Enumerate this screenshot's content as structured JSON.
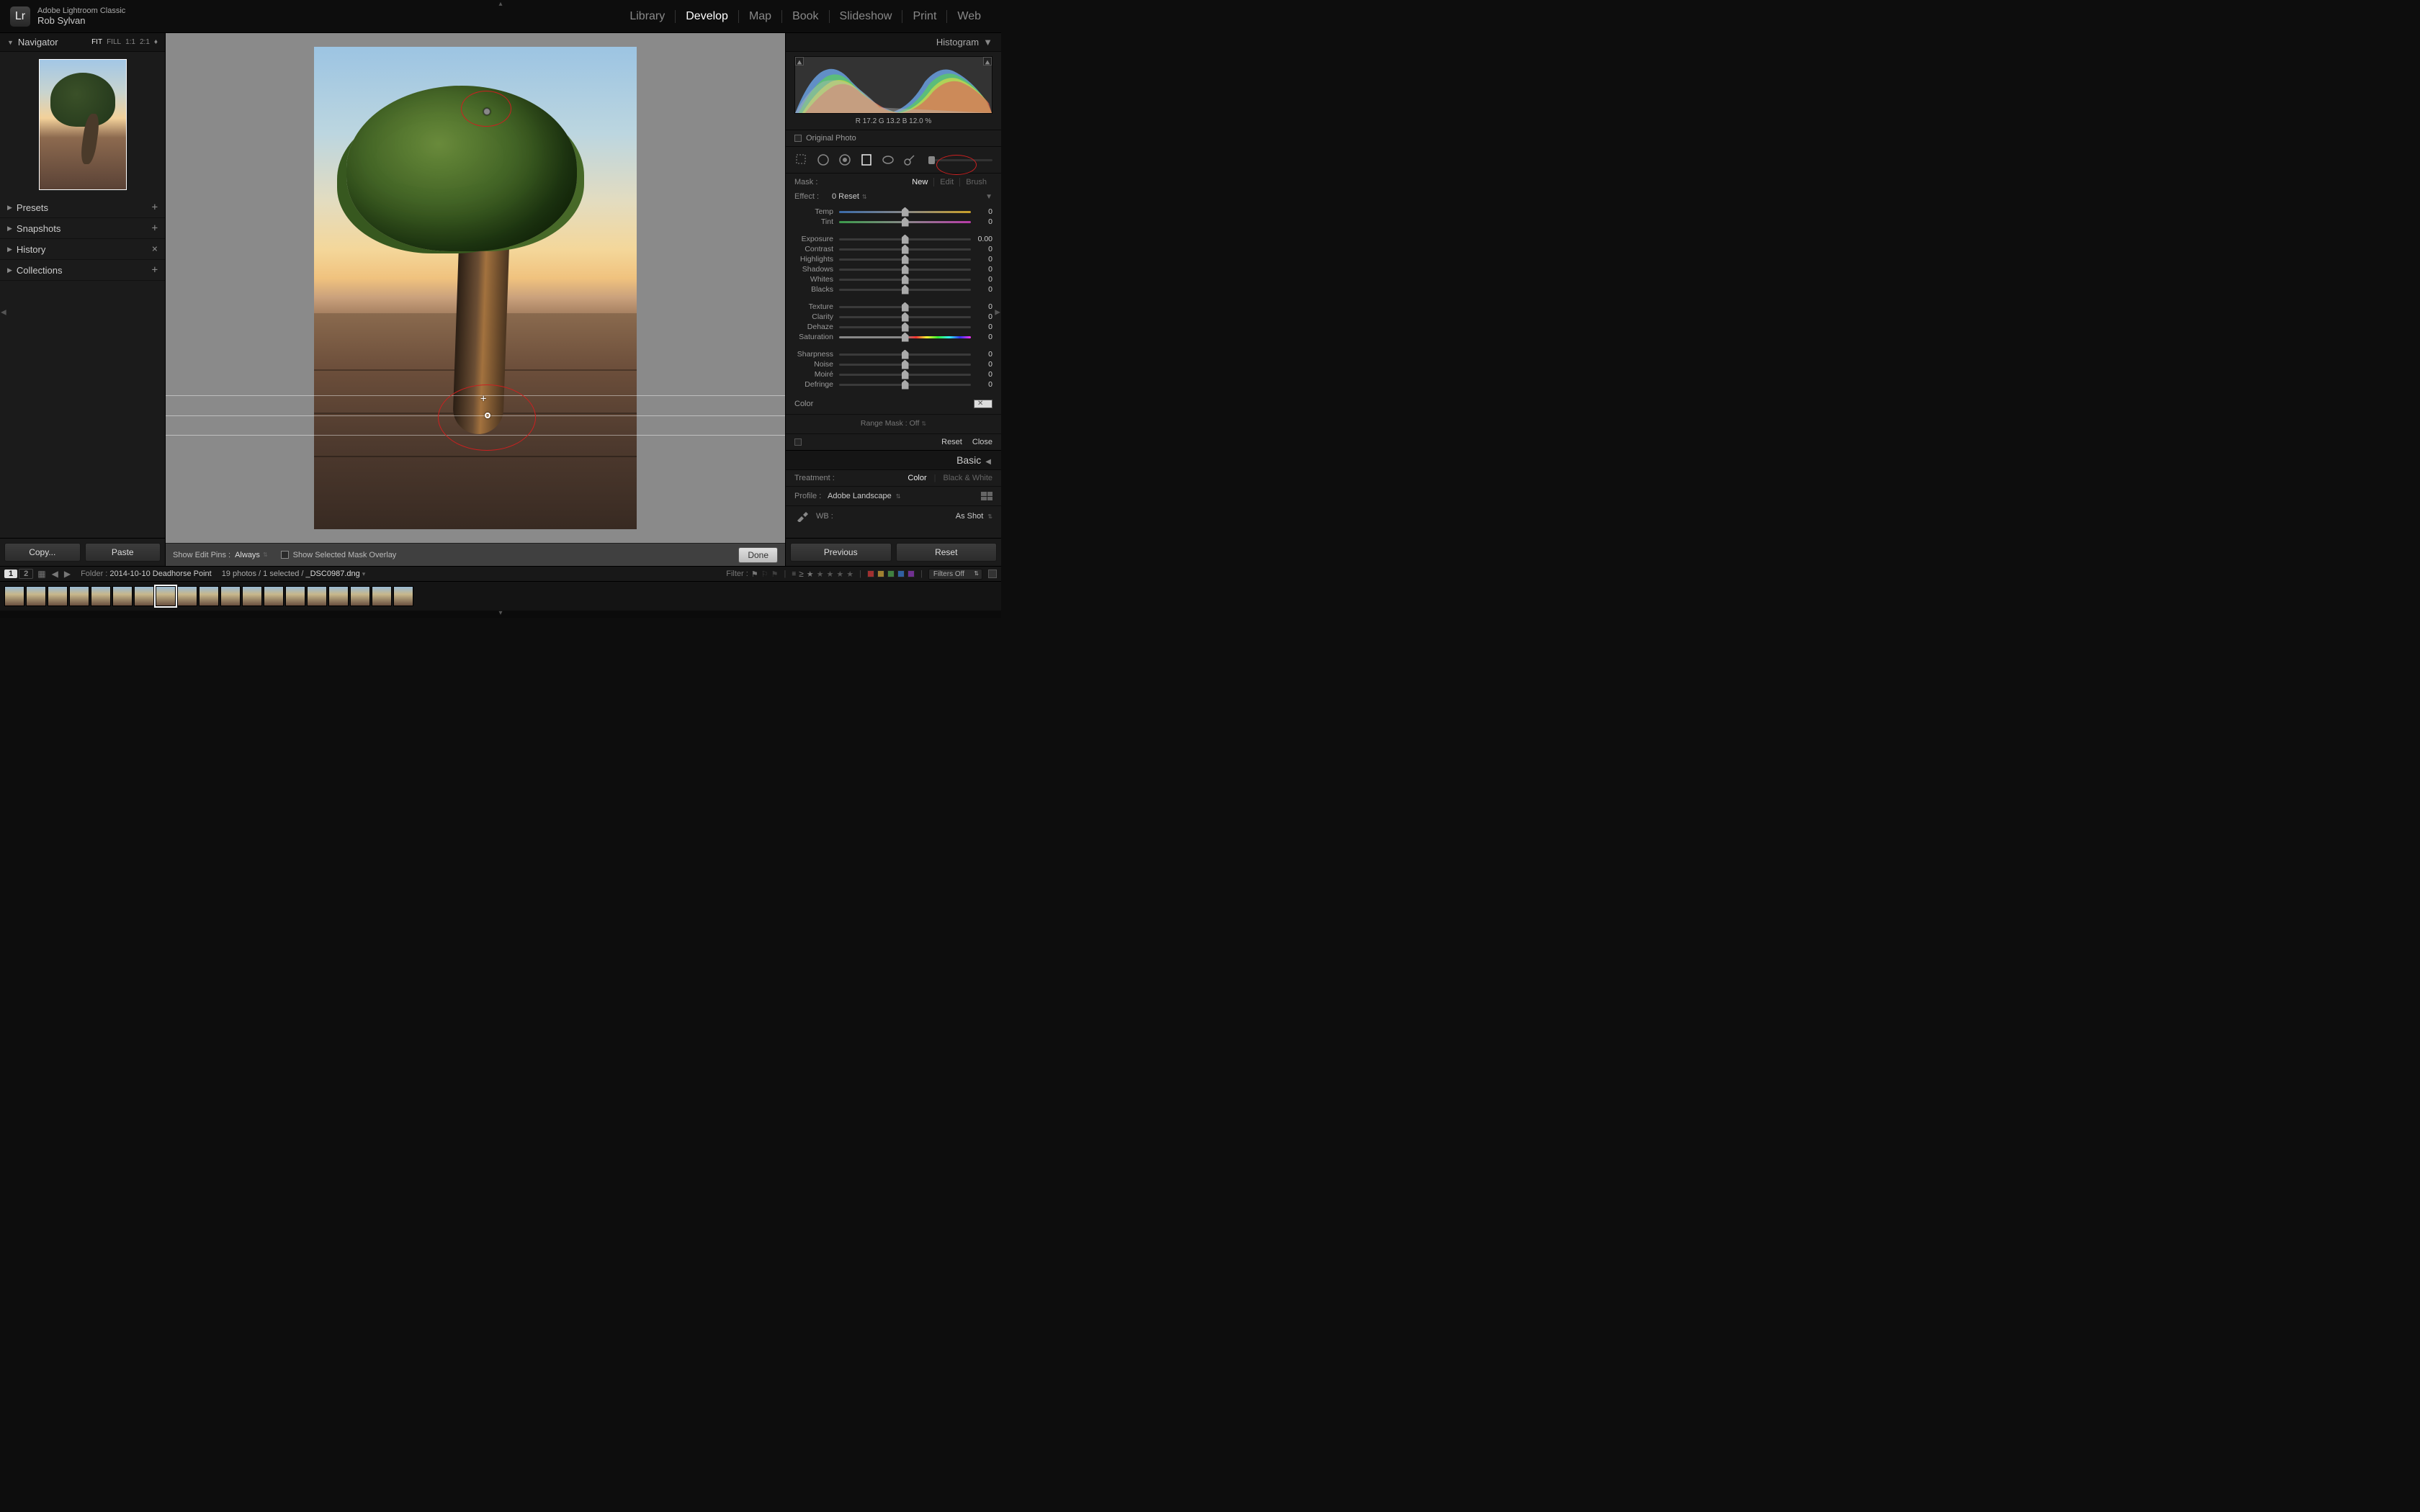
{
  "app": {
    "name": "Adobe Lightroom Classic",
    "user": "Rob Sylvan",
    "logo": "Lr"
  },
  "modules": [
    "Library",
    "Develop",
    "Map",
    "Book",
    "Slideshow",
    "Print",
    "Web"
  ],
  "active_module": "Develop",
  "navigator": {
    "title": "Navigator",
    "zoom_options": [
      "FIT",
      "FILL",
      "1:1",
      "2:1"
    ],
    "zoom_active": "FIT"
  },
  "left_panels": [
    {
      "title": "Presets",
      "action": "+"
    },
    {
      "title": "Snapshots",
      "action": "+"
    },
    {
      "title": "History",
      "action": "×"
    },
    {
      "title": "Collections",
      "action": "+"
    }
  ],
  "left_buttons": {
    "copy": "Copy...",
    "paste": "Paste"
  },
  "center_toolbar": {
    "show_edit_pins_label": "Show Edit Pins :",
    "show_edit_pins_value": "Always",
    "overlay_label": "Show Selected Mask Overlay",
    "done": "Done"
  },
  "histogram": {
    "title": "Histogram",
    "rgb": "R   17.2   G   13.2   B   12.0 %",
    "original_label": "Original Photo"
  },
  "mask": {
    "label": "Mask :",
    "options": [
      "New",
      "Edit",
      "Brush"
    ],
    "active": "New"
  },
  "effect": {
    "label": "Effect :",
    "value": "0 Reset"
  },
  "sliders_a": [
    {
      "name": "Temp",
      "value": "0",
      "track": "temp"
    },
    {
      "name": "Tint",
      "value": "0",
      "track": "tint"
    }
  ],
  "sliders_b": [
    {
      "name": "Exposure",
      "value": "0.00"
    },
    {
      "name": "Contrast",
      "value": "0"
    },
    {
      "name": "Highlights",
      "value": "0"
    },
    {
      "name": "Shadows",
      "value": "0"
    },
    {
      "name": "Whites",
      "value": "0"
    },
    {
      "name": "Blacks",
      "value": "0"
    }
  ],
  "sliders_c": [
    {
      "name": "Texture",
      "value": "0"
    },
    {
      "name": "Clarity",
      "value": "0"
    },
    {
      "name": "Dehaze",
      "value": "0"
    },
    {
      "name": "Saturation",
      "value": "0",
      "track": "sat"
    }
  ],
  "sliders_d": [
    {
      "name": "Sharpness",
      "value": "0"
    },
    {
      "name": "Noise",
      "value": "0"
    },
    {
      "name": "Moiré",
      "value": "0"
    },
    {
      "name": "Defringe",
      "value": "0"
    }
  ],
  "color_label": "Color",
  "range_mask": {
    "label": "Range Mask :",
    "value": "Off"
  },
  "reset_close": {
    "reset": "Reset",
    "close": "Close"
  },
  "basic": {
    "title": "Basic",
    "treatment_label": "Treatment :",
    "treatment_options": [
      "Color",
      "Black & White"
    ],
    "treatment_active": "Color",
    "profile_label": "Profile :",
    "profile_value": "Adobe Landscape",
    "wb_label": "WB :",
    "wb_value": "As Shot"
  },
  "right_buttons": {
    "previous": "Previous",
    "reset": "Reset"
  },
  "infobar": {
    "folder_label": "Folder :",
    "folder": "2014-10-10 Deadhorse Point",
    "count": "19 photos / 1 selected /",
    "filename": "_DSC0987.dng",
    "filter_label": "Filter :",
    "filters_off": "Filters Off"
  },
  "filmstrip": {
    "count": 19,
    "selected_index": 8
  }
}
